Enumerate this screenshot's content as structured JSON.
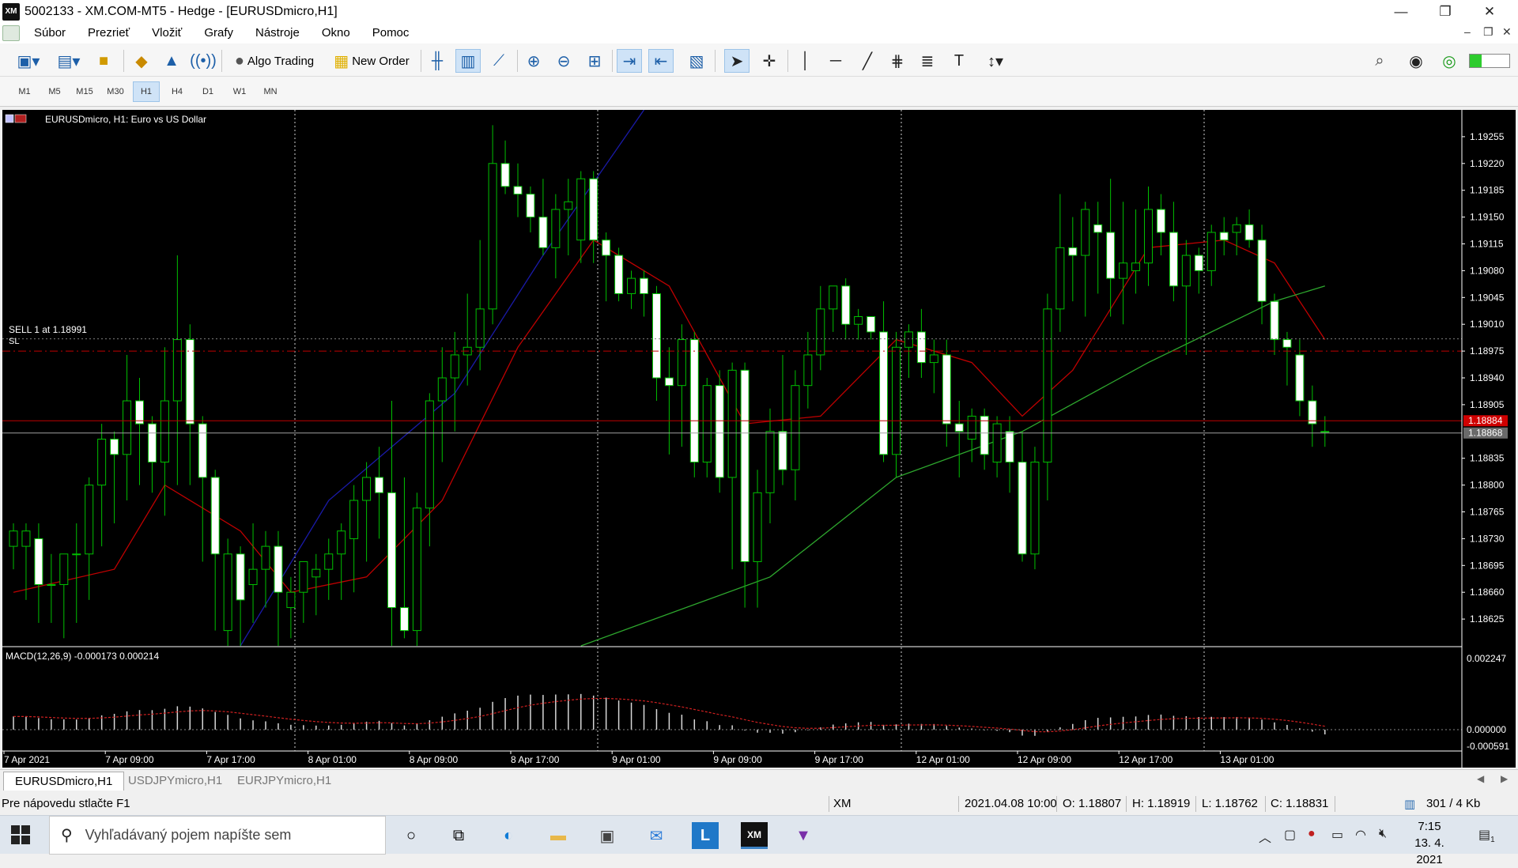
{
  "window": {
    "title": "5002133 - XM.COM-MT5 - Hedge - [EURUSDmicro,H1]",
    "app_icon_text": "XM",
    "buttons": {
      "minimize": "—",
      "maximize": "❐",
      "close": "✕"
    }
  },
  "menu": {
    "items": [
      "Súbor",
      "Prezrieť",
      "Vložiť",
      "Grafy",
      "Nástroje",
      "Okno",
      "Pomoc"
    ],
    "mdi_buttons": {
      "minimize": "–",
      "restore": "❐",
      "close": "✕"
    }
  },
  "toolbar": {
    "algo_trading_label": "Algo Trading",
    "new_order_label": "New Order"
  },
  "timeframes": {
    "items": [
      "M1",
      "M5",
      "M15",
      "M30",
      "H1",
      "H4",
      "D1",
      "W1",
      "MN"
    ],
    "active": "H1"
  },
  "chart": {
    "header": "EURUSDmicro, H1:  Euro vs US Dollar",
    "sell_label": "SELL 1 at 1.18991",
    "sl_label": "SL",
    "macd_label": "MACD(12,26,9) -0.000173 0.000214",
    "price_labels": [
      "1.19255",
      "1.19220",
      "1.19185",
      "1.19150",
      "1.19115",
      "1.19080",
      "1.19045",
      "1.19010",
      "1.18975",
      "1.18940",
      "1.18905",
      "1.18835",
      "1.18800",
      "1.18765",
      "1.18730",
      "1.18695",
      "1.18660",
      "1.18625"
    ],
    "red_price_label": "1.18884",
    "bid_price_label": "1.18868",
    "macd_labels": [
      "0.002247",
      "0.000000",
      "-0.000591"
    ],
    "time_labels": [
      "7 Apr 2021",
      "7 Apr 09:00",
      "7 Apr 17:00",
      "8 Apr 01:00",
      "8 Apr 09:00",
      "8 Apr 17:00",
      "9 Apr 01:00",
      "9 Apr 09:00",
      "9 Apr 17:00",
      "12 Apr 01:00",
      "12 Apr 09:00",
      "12 Apr 17:00",
      "13 Apr 01:00"
    ],
    "colors": {
      "bull_candle": "#00c000",
      "bear_candle": "#ffffff",
      "ma_red": "#c00000",
      "ma_blue": "#1a1aa8",
      "ma_green": "#2ea82e",
      "sell_line": "#808080",
      "sl_line": "#c00000"
    }
  },
  "chart_data": {
    "type": "candlestick",
    "symbol": "EURUSDmicro",
    "timeframe": "H1",
    "y_range": [
      1.1859,
      1.1929
    ],
    "entry_price": 1.18991,
    "sl_price": 1.18975,
    "red_line_price": 1.18884,
    "bid_price": 1.18868,
    "candles": [
      {
        "o": 1.1872,
        "h": 1.1875,
        "l": 1.1869,
        "c": 1.1874
      },
      {
        "o": 1.1872,
        "h": 1.1875,
        "l": 1.1865,
        "c": 1.1874
      },
      {
        "o": 1.1873,
        "h": 1.1875,
        "l": 1.1862,
        "c": 1.1867
      },
      {
        "o": 1.1867,
        "h": 1.1871,
        "l": 1.1862,
        "c": 1.1867
      },
      {
        "o": 1.1867,
        "h": 1.1871,
        "l": 1.186,
        "c": 1.1871
      },
      {
        "o": 1.1871,
        "h": 1.1875,
        "l": 1.1862,
        "c": 1.1871
      },
      {
        "o": 1.1871,
        "h": 1.1881,
        "l": 1.1865,
        "c": 1.188
      },
      {
        "o": 1.188,
        "h": 1.1888,
        "l": 1.1872,
        "c": 1.1886
      },
      {
        "o": 1.1886,
        "h": 1.1887,
        "l": 1.1875,
        "c": 1.1884
      },
      {
        "o": 1.1884,
        "h": 1.1897,
        "l": 1.1878,
        "c": 1.1891
      },
      {
        "o": 1.1891,
        "h": 1.1894,
        "l": 1.188,
        "c": 1.1888
      },
      {
        "o": 1.1888,
        "h": 1.1889,
        "l": 1.1879,
        "c": 1.1883
      },
      {
        "o": 1.1883,
        "h": 1.1898,
        "l": 1.1876,
        "c": 1.1891
      },
      {
        "o": 1.1891,
        "h": 1.191,
        "l": 1.188,
        "c": 1.1899
      },
      {
        "o": 1.1899,
        "h": 1.1901,
        "l": 1.188,
        "c": 1.1888
      },
      {
        "o": 1.1888,
        "h": 1.1889,
        "l": 1.187,
        "c": 1.1881
      },
      {
        "o": 1.1881,
        "h": 1.1882,
        "l": 1.1861,
        "c": 1.1871
      },
      {
        "o": 1.1861,
        "h": 1.1873,
        "l": 1.1859,
        "c": 1.1871
      },
      {
        "o": 1.1871,
        "h": 1.1872,
        "l": 1.1859,
        "c": 1.1865
      },
      {
        "o": 1.1867,
        "h": 1.1875,
        "l": 1.1862,
        "c": 1.1869
      },
      {
        "o": 1.1869,
        "h": 1.1874,
        "l": 1.1864,
        "c": 1.1872
      },
      {
        "o": 1.1872,
        "h": 1.1874,
        "l": 1.1859,
        "c": 1.1866
      },
      {
        "o": 1.1864,
        "h": 1.1868,
        "l": 1.186,
        "c": 1.1866
      },
      {
        "o": 1.1866,
        "h": 1.187,
        "l": 1.1862,
        "c": 1.187
      },
      {
        "o": 1.1868,
        "h": 1.1871,
        "l": 1.1863,
        "c": 1.1869
      },
      {
        "o": 1.1869,
        "h": 1.1873,
        "l": 1.1865,
        "c": 1.1871
      },
      {
        "o": 1.1871,
        "h": 1.1875,
        "l": 1.1865,
        "c": 1.1874
      },
      {
        "o": 1.1873,
        "h": 1.188,
        "l": 1.1866,
        "c": 1.1878
      },
      {
        "o": 1.1878,
        "h": 1.1883,
        "l": 1.187,
        "c": 1.1881
      },
      {
        "o": 1.1881,
        "h": 1.1885,
        "l": 1.1873,
        "c": 1.1879
      },
      {
        "o": 1.1879,
        "h": 1.1891,
        "l": 1.1859,
        "c": 1.1864
      },
      {
        "o": 1.1864,
        "h": 1.1881,
        "l": 1.186,
        "c": 1.1861
      },
      {
        "o": 1.1861,
        "h": 1.1879,
        "l": 1.1859,
        "c": 1.1877
      },
      {
        "o": 1.1877,
        "h": 1.1892,
        "l": 1.1872,
        "c": 1.1891
      },
      {
        "o": 1.1891,
        "h": 1.1898,
        "l": 1.1883,
        "c": 1.1894
      },
      {
        "o": 1.1894,
        "h": 1.19,
        "l": 1.1887,
        "c": 1.1897
      },
      {
        "o": 1.1897,
        "h": 1.1905,
        "l": 1.1893,
        "c": 1.1898
      },
      {
        "o": 1.1898,
        "h": 1.1912,
        "l": 1.1895,
        "c": 1.1903
      },
      {
        "o": 1.1903,
        "h": 1.1927,
        "l": 1.1901,
        "c": 1.1922
      },
      {
        "o": 1.1922,
        "h": 1.1925,
        "l": 1.1918,
        "c": 1.1919
      },
      {
        "o": 1.1919,
        "h": 1.1922,
        "l": 1.1915,
        "c": 1.1918
      },
      {
        "o": 1.1918,
        "h": 1.1919,
        "l": 1.1913,
        "c": 1.1915
      },
      {
        "o": 1.1915,
        "h": 1.192,
        "l": 1.191,
        "c": 1.1911
      },
      {
        "o": 1.1911,
        "h": 1.1918,
        "l": 1.1907,
        "c": 1.1916
      },
      {
        "o": 1.1916,
        "h": 1.192,
        "l": 1.191,
        "c": 1.1917
      },
      {
        "o": 1.1912,
        "h": 1.1921,
        "l": 1.1909,
        "c": 1.192
      },
      {
        "o": 1.192,
        "h": 1.1921,
        "l": 1.1909,
        "c": 1.1912
      },
      {
        "o": 1.1912,
        "h": 1.1913,
        "l": 1.1904,
        "c": 1.191
      },
      {
        "o": 1.191,
        "h": 1.1911,
        "l": 1.1904,
        "c": 1.1905
      },
      {
        "o": 1.1905,
        "h": 1.1908,
        "l": 1.1903,
        "c": 1.1907
      },
      {
        "o": 1.1907,
        "h": 1.1908,
        "l": 1.1902,
        "c": 1.1905
      },
      {
        "o": 1.1905,
        "h": 1.1906,
        "l": 1.1891,
        "c": 1.1894
      },
      {
        "o": 1.1894,
        "h": 1.1898,
        "l": 1.1884,
        "c": 1.1893
      },
      {
        "o": 1.1893,
        "h": 1.1901,
        "l": 1.1885,
        "c": 1.1899
      },
      {
        "o": 1.1899,
        "h": 1.19,
        "l": 1.1881,
        "c": 1.1883
      },
      {
        "o": 1.1883,
        "h": 1.1894,
        "l": 1.1881,
        "c": 1.1893
      },
      {
        "o": 1.1893,
        "h": 1.1895,
        "l": 1.1879,
        "c": 1.1881
      },
      {
        "o": 1.1881,
        "h": 1.1896,
        "l": 1.1869,
        "c": 1.1895
      },
      {
        "o": 1.1895,
        "h": 1.1896,
        "l": 1.1864,
        "c": 1.187
      },
      {
        "o": 1.187,
        "h": 1.1882,
        "l": 1.1864,
        "c": 1.1879
      },
      {
        "o": 1.1879,
        "h": 1.189,
        "l": 1.1875,
        "c": 1.1887
      },
      {
        "o": 1.1887,
        "h": 1.1897,
        "l": 1.188,
        "c": 1.1882
      },
      {
        "o": 1.1882,
        "h": 1.1895,
        "l": 1.1878,
        "c": 1.1893
      },
      {
        "o": 1.1893,
        "h": 1.19,
        "l": 1.189,
        "c": 1.1897
      },
      {
        "o": 1.1897,
        "h": 1.1906,
        "l": 1.1895,
        "c": 1.1903
      },
      {
        "o": 1.1903,
        "h": 1.1906,
        "l": 1.19,
        "c": 1.1906
      },
      {
        "o": 1.1906,
        "h": 1.1907,
        "l": 1.1899,
        "c": 1.1901
      },
      {
        "o": 1.1901,
        "h": 1.1903,
        "l": 1.1899,
        "c": 1.1902
      },
      {
        "o": 1.1902,
        "h": 1.1902,
        "l": 1.1899,
        "c": 1.19
      },
      {
        "o": 1.19,
        "h": 1.1904,
        "l": 1.1883,
        "c": 1.1884
      },
      {
        "o": 1.1884,
        "h": 1.19,
        "l": 1.1881,
        "c": 1.1898
      },
      {
        "o": 1.1898,
        "h": 1.1901,
        "l": 1.1894,
        "c": 1.19
      },
      {
        "o": 1.19,
        "h": 1.1903,
        "l": 1.1894,
        "c": 1.1896
      },
      {
        "o": 1.1896,
        "h": 1.1899,
        "l": 1.1892,
        "c": 1.1897
      },
      {
        "o": 1.1897,
        "h": 1.1899,
        "l": 1.1885,
        "c": 1.1888
      },
      {
        "o": 1.1888,
        "h": 1.1891,
        "l": 1.1881,
        "c": 1.1887
      },
      {
        "o": 1.1886,
        "h": 1.189,
        "l": 1.1883,
        "c": 1.1889
      },
      {
        "o": 1.1889,
        "h": 1.189,
        "l": 1.1882,
        "c": 1.1884
      },
      {
        "o": 1.1883,
        "h": 1.1889,
        "l": 1.1881,
        "c": 1.1888
      },
      {
        "o": 1.1887,
        "h": 1.1889,
        "l": 1.1879,
        "c": 1.1883
      },
      {
        "o": 1.1883,
        "h": 1.1887,
        "l": 1.187,
        "c": 1.1871
      },
      {
        "o": 1.1871,
        "h": 1.1885,
        "l": 1.1869,
        "c": 1.1883
      },
      {
        "o": 1.1883,
        "h": 1.1905,
        "l": 1.1878,
        "c": 1.1903
      },
      {
        "o": 1.1903,
        "h": 1.1918,
        "l": 1.19,
        "c": 1.1911
      },
      {
        "o": 1.1911,
        "h": 1.1915,
        "l": 1.1904,
        "c": 1.191
      },
      {
        "o": 1.191,
        "h": 1.1917,
        "l": 1.1902,
        "c": 1.1916
      },
      {
        "o": 1.1914,
        "h": 1.1917,
        "l": 1.1905,
        "c": 1.1913
      },
      {
        "o": 1.1913,
        "h": 1.192,
        "l": 1.1902,
        "c": 1.1907
      },
      {
        "o": 1.1907,
        "h": 1.1917,
        "l": 1.1901,
        "c": 1.1909
      },
      {
        "o": 1.1908,
        "h": 1.1916,
        "l": 1.1905,
        "c": 1.1909
      },
      {
        "o": 1.1909,
        "h": 1.1919,
        "l": 1.1906,
        "c": 1.1916
      },
      {
        "o": 1.1916,
        "h": 1.1918,
        "l": 1.191,
        "c": 1.1913
      },
      {
        "o": 1.1913,
        "h": 1.1917,
        "l": 1.1904,
        "c": 1.1906
      },
      {
        "o": 1.1906,
        "h": 1.1912,
        "l": 1.1897,
        "c": 1.191
      },
      {
        "o": 1.191,
        "h": 1.1911,
        "l": 1.1905,
        "c": 1.1908
      },
      {
        "o": 1.1908,
        "h": 1.1914,
        "l": 1.1906,
        "c": 1.1913
      },
      {
        "o": 1.1913,
        "h": 1.1915,
        "l": 1.191,
        "c": 1.1912
      },
      {
        "o": 1.1913,
        "h": 1.1915,
        "l": 1.191,
        "c": 1.1914
      },
      {
        "o": 1.1914,
        "h": 1.1916,
        "l": 1.1911,
        "c": 1.1912
      },
      {
        "o": 1.1912,
        "h": 1.1914,
        "l": 1.1901,
        "c": 1.1904
      },
      {
        "o": 1.1904,
        "h": 1.1905,
        "l": 1.1897,
        "c": 1.1899
      },
      {
        "o": 1.1899,
        "h": 1.19,
        "l": 1.1893,
        "c": 1.1898
      },
      {
        "o": 1.1897,
        "h": 1.1899,
        "l": 1.1889,
        "c": 1.1891
      },
      {
        "o": 1.1891,
        "h": 1.1893,
        "l": 1.1885,
        "c": 1.1888
      },
      {
        "o": 1.1887,
        "h": 1.1889,
        "l": 1.1885,
        "c": 1.1887
      }
    ],
    "moving_averages": [
      {
        "name": "ma_red",
        "points": [
          [
            0,
            1.1866
          ],
          [
            8,
            1.1869
          ],
          [
            12,
            1.188
          ],
          [
            18,
            1.1874
          ],
          [
            22,
            1.1866
          ],
          [
            28,
            1.1868
          ],
          [
            34,
            1.1878
          ],
          [
            40,
            1.1898
          ],
          [
            46,
            1.1912
          ],
          [
            52,
            1.1906
          ],
          [
            58,
            1.1888
          ],
          [
            64,
            1.1889
          ],
          [
            70,
            1.1899
          ],
          [
            76,
            1.1896
          ],
          [
            80,
            1.1889
          ],
          [
            84,
            1.1895
          ],
          [
            90,
            1.1911
          ],
          [
            96,
            1.1912
          ],
          [
            100,
            1.1909
          ],
          [
            104,
            1.1899
          ]
        ]
      },
      {
        "name": "ma_blue",
        "points": [
          [
            18,
            1.1859
          ],
          [
            25,
            1.1878
          ],
          [
            35,
            1.1892
          ],
          [
            42,
            1.191
          ],
          [
            50,
            1.1929
          ]
        ]
      },
      {
        "name": "ma_green",
        "points": [
          [
            45,
            1.1859
          ],
          [
            60,
            1.1868
          ],
          [
            70,
            1.1881
          ],
          [
            80,
            1.1887
          ],
          [
            90,
            1.1896
          ],
          [
            100,
            1.1904
          ],
          [
            104,
            1.1906
          ]
        ]
      }
    ]
  },
  "tabs": [
    "EURUSDmicro,H1",
    "USDJPYmicro,H1",
    "EURJPYmicro,H1"
  ],
  "status": {
    "help": "Pre nápovedu stlačte F1",
    "profile": "XM",
    "time": "2021.04.08 10:00",
    "open": "O: 1.18807",
    "high": "H: 1.18919",
    "low": "L: 1.18762",
    "close": "C: 1.18831",
    "traffic": "301 / 4 Kb"
  },
  "taskbar": {
    "search_placeholder": "Vyhľadávaný pojem napíšte sem",
    "time": "7:15",
    "date": "13. 4. 2021",
    "notification_count": "1"
  }
}
